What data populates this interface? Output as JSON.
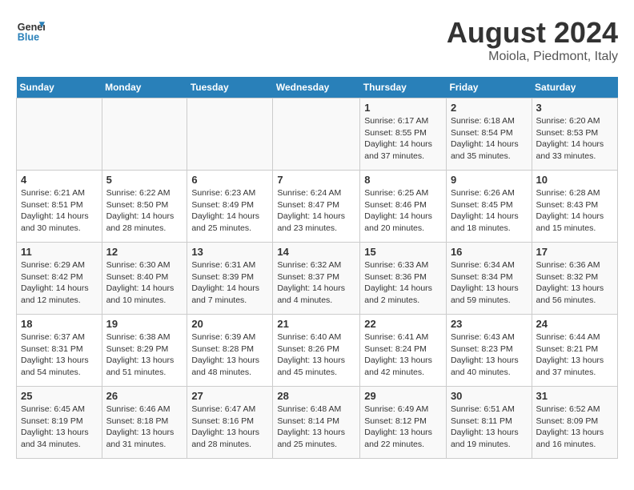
{
  "header": {
    "logo_line1": "General",
    "logo_line2": "Blue",
    "month": "August 2024",
    "location": "Moiola, Piedmont, Italy"
  },
  "days_of_week": [
    "Sunday",
    "Monday",
    "Tuesday",
    "Wednesday",
    "Thursday",
    "Friday",
    "Saturday"
  ],
  "weeks": [
    [
      {
        "day": "",
        "info": ""
      },
      {
        "day": "",
        "info": ""
      },
      {
        "day": "",
        "info": ""
      },
      {
        "day": "",
        "info": ""
      },
      {
        "day": "1",
        "info": "Sunrise: 6:17 AM\nSunset: 8:55 PM\nDaylight: 14 hours and 37 minutes."
      },
      {
        "day": "2",
        "info": "Sunrise: 6:18 AM\nSunset: 8:54 PM\nDaylight: 14 hours and 35 minutes."
      },
      {
        "day": "3",
        "info": "Sunrise: 6:20 AM\nSunset: 8:53 PM\nDaylight: 14 hours and 33 minutes."
      }
    ],
    [
      {
        "day": "4",
        "info": "Sunrise: 6:21 AM\nSunset: 8:51 PM\nDaylight: 14 hours and 30 minutes."
      },
      {
        "day": "5",
        "info": "Sunrise: 6:22 AM\nSunset: 8:50 PM\nDaylight: 14 hours and 28 minutes."
      },
      {
        "day": "6",
        "info": "Sunrise: 6:23 AM\nSunset: 8:49 PM\nDaylight: 14 hours and 25 minutes."
      },
      {
        "day": "7",
        "info": "Sunrise: 6:24 AM\nSunset: 8:47 PM\nDaylight: 14 hours and 23 minutes."
      },
      {
        "day": "8",
        "info": "Sunrise: 6:25 AM\nSunset: 8:46 PM\nDaylight: 14 hours and 20 minutes."
      },
      {
        "day": "9",
        "info": "Sunrise: 6:26 AM\nSunset: 8:45 PM\nDaylight: 14 hours and 18 minutes."
      },
      {
        "day": "10",
        "info": "Sunrise: 6:28 AM\nSunset: 8:43 PM\nDaylight: 14 hours and 15 minutes."
      }
    ],
    [
      {
        "day": "11",
        "info": "Sunrise: 6:29 AM\nSunset: 8:42 PM\nDaylight: 14 hours and 12 minutes."
      },
      {
        "day": "12",
        "info": "Sunrise: 6:30 AM\nSunset: 8:40 PM\nDaylight: 14 hours and 10 minutes."
      },
      {
        "day": "13",
        "info": "Sunrise: 6:31 AM\nSunset: 8:39 PM\nDaylight: 14 hours and 7 minutes."
      },
      {
        "day": "14",
        "info": "Sunrise: 6:32 AM\nSunset: 8:37 PM\nDaylight: 14 hours and 4 minutes."
      },
      {
        "day": "15",
        "info": "Sunrise: 6:33 AM\nSunset: 8:36 PM\nDaylight: 14 hours and 2 minutes."
      },
      {
        "day": "16",
        "info": "Sunrise: 6:34 AM\nSunset: 8:34 PM\nDaylight: 13 hours and 59 minutes."
      },
      {
        "day": "17",
        "info": "Sunrise: 6:36 AM\nSunset: 8:32 PM\nDaylight: 13 hours and 56 minutes."
      }
    ],
    [
      {
        "day": "18",
        "info": "Sunrise: 6:37 AM\nSunset: 8:31 PM\nDaylight: 13 hours and 54 minutes."
      },
      {
        "day": "19",
        "info": "Sunrise: 6:38 AM\nSunset: 8:29 PM\nDaylight: 13 hours and 51 minutes."
      },
      {
        "day": "20",
        "info": "Sunrise: 6:39 AM\nSunset: 8:28 PM\nDaylight: 13 hours and 48 minutes."
      },
      {
        "day": "21",
        "info": "Sunrise: 6:40 AM\nSunset: 8:26 PM\nDaylight: 13 hours and 45 minutes."
      },
      {
        "day": "22",
        "info": "Sunrise: 6:41 AM\nSunset: 8:24 PM\nDaylight: 13 hours and 42 minutes."
      },
      {
        "day": "23",
        "info": "Sunrise: 6:43 AM\nSunset: 8:23 PM\nDaylight: 13 hours and 40 minutes."
      },
      {
        "day": "24",
        "info": "Sunrise: 6:44 AM\nSunset: 8:21 PM\nDaylight: 13 hours and 37 minutes."
      }
    ],
    [
      {
        "day": "25",
        "info": "Sunrise: 6:45 AM\nSunset: 8:19 PM\nDaylight: 13 hours and 34 minutes."
      },
      {
        "day": "26",
        "info": "Sunrise: 6:46 AM\nSunset: 8:18 PM\nDaylight: 13 hours and 31 minutes."
      },
      {
        "day": "27",
        "info": "Sunrise: 6:47 AM\nSunset: 8:16 PM\nDaylight: 13 hours and 28 minutes."
      },
      {
        "day": "28",
        "info": "Sunrise: 6:48 AM\nSunset: 8:14 PM\nDaylight: 13 hours and 25 minutes."
      },
      {
        "day": "29",
        "info": "Sunrise: 6:49 AM\nSunset: 8:12 PM\nDaylight: 13 hours and 22 minutes."
      },
      {
        "day": "30",
        "info": "Sunrise: 6:51 AM\nSunset: 8:11 PM\nDaylight: 13 hours and 19 minutes."
      },
      {
        "day": "31",
        "info": "Sunrise: 6:52 AM\nSunset: 8:09 PM\nDaylight: 13 hours and 16 minutes."
      }
    ]
  ]
}
